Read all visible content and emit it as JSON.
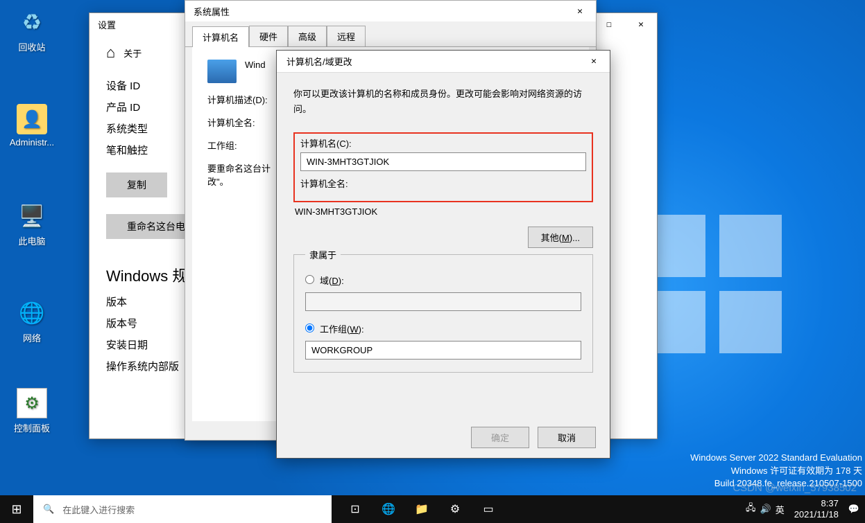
{
  "desktop": {
    "recycle": "回收站",
    "admin": "Administr...",
    "thispc": "此电脑",
    "network": "网络",
    "cpanel": "控制面板"
  },
  "settings": {
    "title": "设置",
    "heading": "关于",
    "device_id": "设备 ID",
    "product_id": "产品 ID",
    "system_type": "系统类型",
    "pen_touch": "笔和触控",
    "copy": "复制",
    "rename": "重命名这台电",
    "spec_heading": "Windows 规",
    "version": "版本",
    "version_num": "版本号",
    "install_date": "安装日期",
    "os_build": "操作系统内部版"
  },
  "sysprop": {
    "title": "系统属性",
    "tabs": {
      "name": "计算机名",
      "hardware": "硬件",
      "advanced": "高级",
      "remote": "远程"
    },
    "intro": "Wind",
    "desc_label": "计算机描述(D):",
    "fullname_label": "计算机全名:",
    "workgroup_label": "工作组:",
    "rename_msg": "要重命名这台计",
    "rename_msg2": "改\"。"
  },
  "changes": {
    "title": "计算机名/域更改",
    "desc": "你可以更改该计算机的名称和成员身份。更改可能会影响对网络资源的访问。",
    "name_label": "计算机名(C):",
    "name_value": "WIN-3MHT3GTJIOK",
    "fullname_label": "计算机全名:",
    "fullname_value": "WIN-3MHT3GTJIOK",
    "other": "其他(M)...",
    "member_legend": "隶属于",
    "domain_label": "域(D):",
    "workgroup_label": "工作组(W):",
    "workgroup_value": "WORKGROUP",
    "ok": "确定",
    "cancel": "取消"
  },
  "buildinfo": {
    "l1": "Windows Server 2022 Standard Evaluation",
    "l2": "Windows 许可证有效期为 178 天",
    "l3": "Build 20348.fe_release.210507-1500"
  },
  "watermark": "CSDN @weixin_57938502",
  "taskbar": {
    "search": "在此键入进行搜索",
    "time": "8:37",
    "date": "2021/11/18"
  }
}
